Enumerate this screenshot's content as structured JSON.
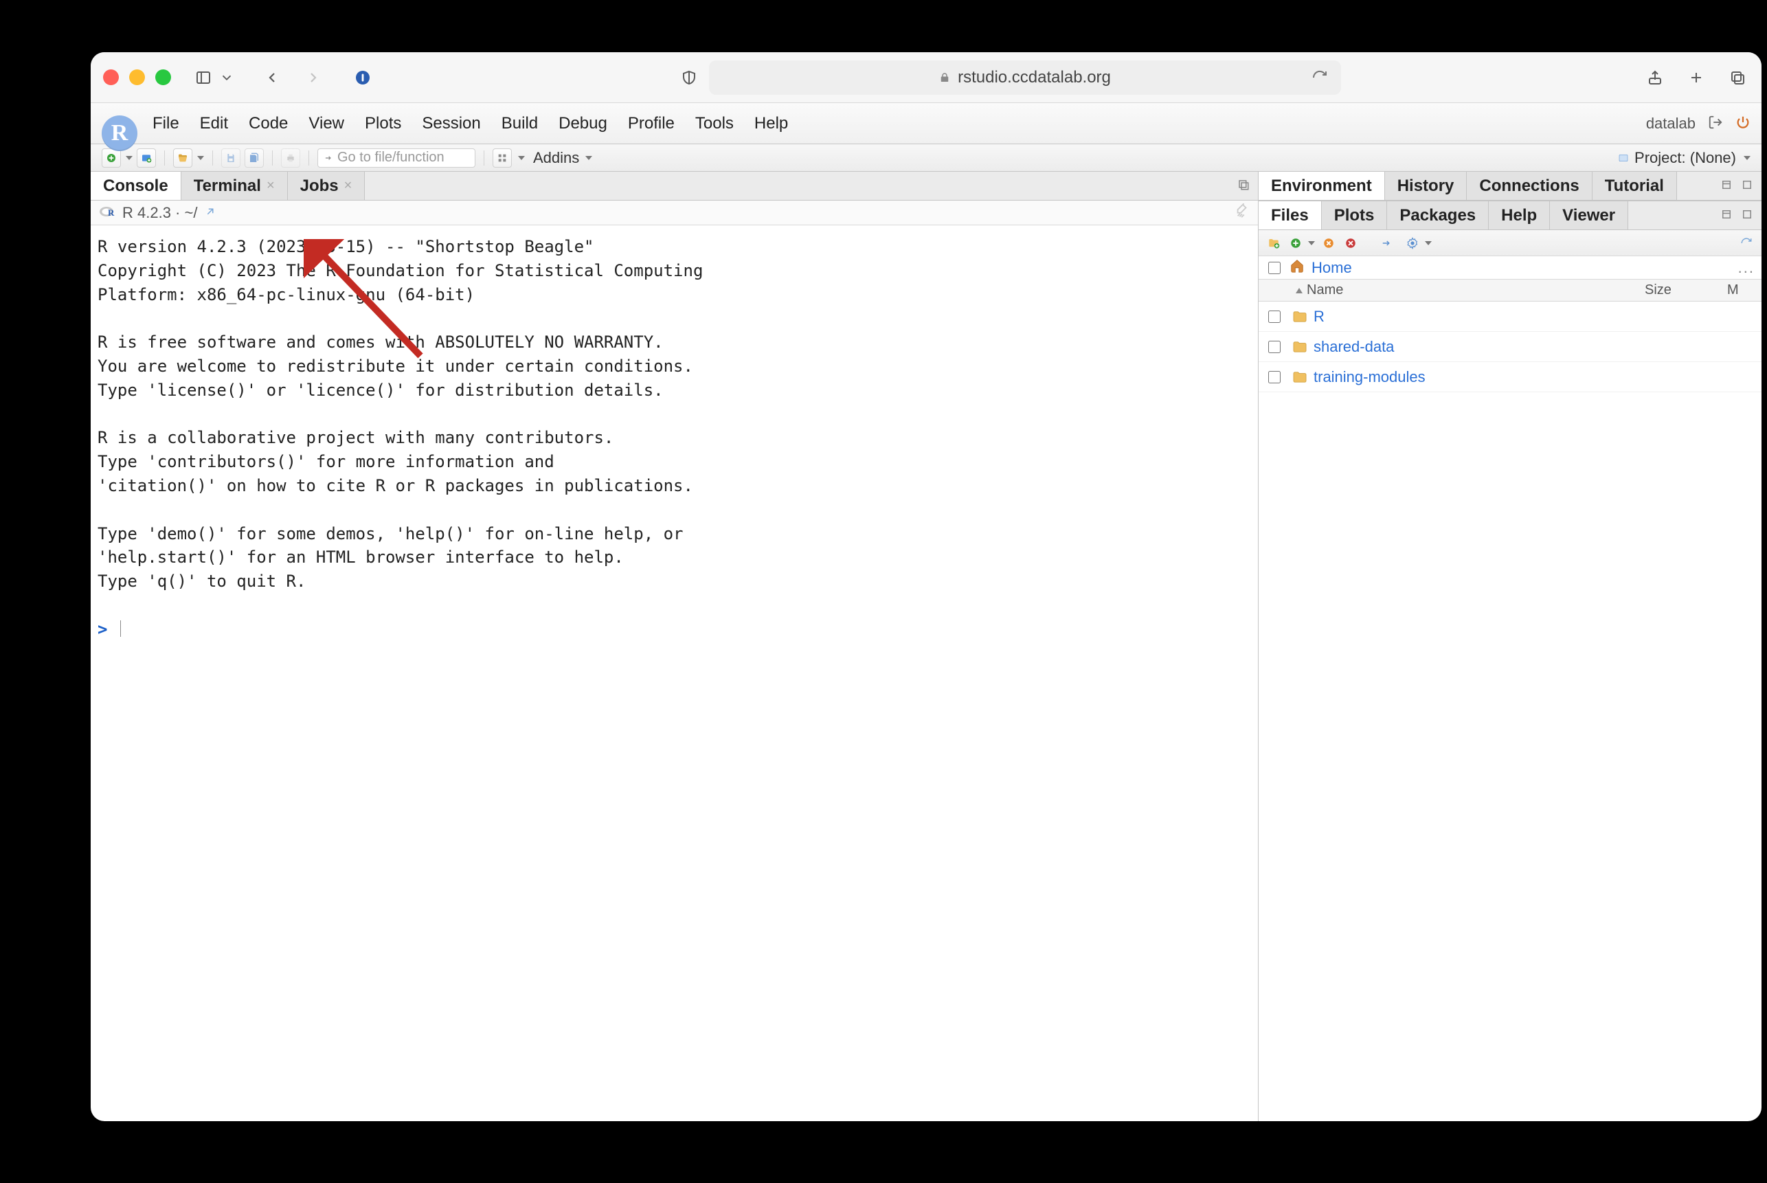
{
  "browser": {
    "url": "rstudio.ccdatalab.org"
  },
  "menubar": {
    "items": [
      "File",
      "Edit",
      "Code",
      "View",
      "Plots",
      "Session",
      "Build",
      "Debug",
      "Profile",
      "Tools",
      "Help"
    ],
    "user": "datalab"
  },
  "toolbar": {
    "goto_placeholder": "Go to file/function",
    "addins_label": "Addins",
    "project_label": "Project: (None)"
  },
  "left": {
    "tabs": [
      "Console",
      "Terminal",
      "Jobs"
    ],
    "subbar": "R 4.2.3 · ~/",
    "console_text": "R version 4.2.3 (2023-03-15) -- \"Shortstop Beagle\"\nCopyright (C) 2023 The R Foundation for Statistical Computing\nPlatform: x86_64-pc-linux-gnu (64-bit)\n\nR is free software and comes with ABSOLUTELY NO WARRANTY.\nYou are welcome to redistribute it under certain conditions.\nType 'license()' or 'licence()' for distribution details.\n\nR is a collaborative project with many contributors.\nType 'contributors()' for more information and\n'citation()' on how to cite R or R packages in publications.\n\nType 'demo()' for some demos, 'help()' for on-line help, or\n'help.start()' for an HTML browser interface to help.\nType 'q()' to quit R.\n",
    "prompt": ">"
  },
  "right_upper": {
    "tabs": [
      "Environment",
      "History",
      "Connections",
      "Tutorial"
    ]
  },
  "right_lower": {
    "tabs": [
      "Files",
      "Plots",
      "Packages",
      "Help",
      "Viewer"
    ],
    "breadcrumb_home": "Home",
    "columns": {
      "name": "Name",
      "size": "Size",
      "modified_abbrev": "M"
    },
    "rows": [
      {
        "name": "R"
      },
      {
        "name": "shared-data"
      },
      {
        "name": "training-modules"
      }
    ],
    "more_label": "..."
  }
}
